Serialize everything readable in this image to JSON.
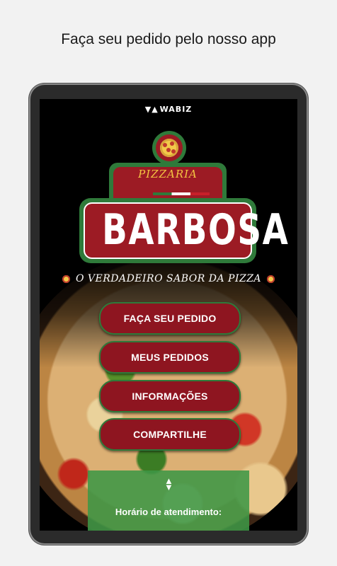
{
  "headline": "Faça seu pedido pelo nosso app",
  "vendor_logo": "WABIZ",
  "brand": {
    "small": "PIZZARIA",
    "big": "BARBOSA",
    "tagline": "O VERDADEIRO SABOR DA PIZZA"
  },
  "menu": {
    "order_label": "FAÇA SEU PEDIDO",
    "my_orders_label": "MEUS PEDIDOS",
    "info_label": "INFORMAÇÕES",
    "share_label": "COMPARTILHE"
  },
  "hours_label": "Horário de atendimento:",
  "colors": {
    "brand_red": "#8e1520",
    "brand_green": "#2f7a3a",
    "panel_green": "#3e9646"
  }
}
